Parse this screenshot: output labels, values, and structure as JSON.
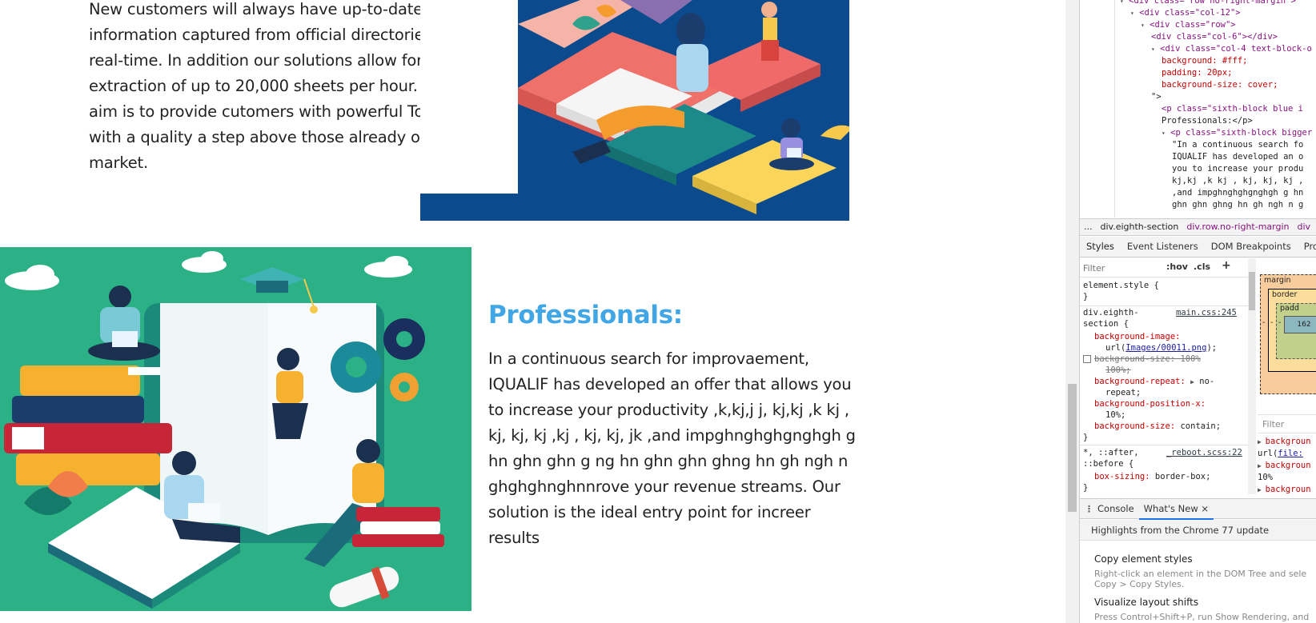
{
  "intro": {
    "paragraph": "New customers will always have up-to-date information captured from official directories in real-time. In addition our solutions allow for the extraction of up to 20,000 sheets per hour. Our aim is to provide cutomers with powerful Tools, with a quality a step above those already on the market."
  },
  "professionals": {
    "title": "Professionals:",
    "paragraph": "In a continuous search for improvaement, IQUALIF has developed an offer that allows you to increase your productivity ,k,kj,j j, kj,kj ,k kj , kj, kj, kj ,kj , kj, kj, jk ,and impghnghghgnghgh g hn ghn ghn g ng hn ghn ghn ghng hn gh ngh n ghghghnghnnrove your revenue streams. Our solution is the ideal entry point for increer results"
  },
  "colors": {
    "illus_top_bg": "#0b4a8c",
    "illus_bottom_bg": "#2bb185",
    "title_blue": "#41a6e6"
  },
  "devtools": {
    "dom_lines": [
      {
        "indent": 0,
        "tri": "▾",
        "html": "<div class=\"row no-right-margin\">"
      },
      {
        "indent": 1,
        "tri": "▾",
        "html": "<div class=\"col-12\">"
      },
      {
        "indent": 2,
        "tri": "▾",
        "html": "<div class=\"row\">"
      },
      {
        "indent": 3,
        "tri": "",
        "html": "<div class=\"col-6\"></div>"
      },
      {
        "indent": 3,
        "tri": "▾",
        "html": "<div class=\"col-4 text-block-o"
      },
      {
        "indent": 4,
        "tri": "",
        "css": "background: #fff;"
      },
      {
        "indent": 4,
        "tri": "",
        "css": "padding: 20px;"
      },
      {
        "indent": 4,
        "tri": "",
        "css": "background-size: cover;"
      },
      {
        "indent": 3,
        "tri": "",
        "plain": "\">"
      },
      {
        "indent": 4,
        "tri": "",
        "html": "<p class=\"sixth-block blue i"
      },
      {
        "indent": 4,
        "tri": "",
        "plain": "Professionals:</p>"
      },
      {
        "indent": 4,
        "tri": "▾",
        "html": "<p class=\"sixth-block bigger"
      },
      {
        "indent": 5,
        "tri": "",
        "plain": "\"In a continuous search fo"
      },
      {
        "indent": 5,
        "tri": "",
        "plain": "IQUALIF has developed an o"
      },
      {
        "indent": 5,
        "tri": "",
        "plain": "you to increase your produ"
      },
      {
        "indent": 5,
        "tri": "",
        "plain": "kj,kj ,k kj , kj, kj, kj ,"
      },
      {
        "indent": 5,
        "tri": "",
        "plain": ",and impghnghghgnghgh g hn"
      },
      {
        "indent": 5,
        "tri": "",
        "plain": "ghn ghn ghng hn gh ngh n g"
      }
    ],
    "breadcrumbs": [
      "...",
      "div.eighth-section",
      "div.row.no-right-margin",
      "div"
    ],
    "panel_tabs": [
      "Styles",
      "Event Listeners",
      "DOM Breakpoints",
      "Prop"
    ],
    "filter_placeholder": "Filter",
    "toolbar": {
      "hov": ":hov",
      "cls": ".cls",
      "add": "+"
    },
    "rules": {
      "element_style": "element.style {",
      "close": "}",
      "eighth_selector_1": "div.eighth-",
      "eighth_selector_2": "section {",
      "eighth_source": "main.css:245",
      "bg_image_prop": "background-image:",
      "bg_image_url_pre": "url(",
      "bg_image_url": "Images/00011.png",
      "bg_image_url_post": ");",
      "bg_size_struck_1": "background-size: 100%",
      "bg_size_struck_2": "100%;",
      "bg_repeat_prop": "background-repeat:",
      "bg_repeat_val_1": "no-",
      "bg_repeat_val_2": "repeat;",
      "bg_posx_prop": "background-position-x:",
      "bg_posx_val": "10%;",
      "bg_size_prop": "background-size:",
      "bg_size_val": "contain;",
      "reboot_selector_1": "*, ::after,",
      "reboot_selector_2": "::before {",
      "reboot_source": "_reboot.scss:22",
      "box_sizing_prop": "box-sizing:",
      "box_sizing_val": "border-box;"
    },
    "box_model": {
      "margin": "margin",
      "border": "border",
      "padding": "padd",
      "content": "162",
      "dash": "-"
    },
    "computed_filter": "Filter",
    "computed": [
      {
        "prop": "backgroun",
        "val": ""
      },
      {
        "prop": "url(",
        "val": "file:"
      },
      {
        "prop": "backgroun",
        "val": ""
      },
      {
        "prop": "10%",
        "val": ""
      },
      {
        "prop": "backgroun",
        "val": ""
      }
    ],
    "drawer_tabs": [
      "Console",
      "What's New"
    ],
    "drawer_close": "×",
    "whats_new": {
      "header": "Highlights from the Chrome 77 update",
      "item1_title": "Copy element styles",
      "item1_desc_1": "Right-click an element in the DOM Tree and sele",
      "item1_desc_2": "Copy > Copy Styles.",
      "item2_title": "Visualize layout shifts",
      "item2_desc_1": "Press Control+Shift+P, run Show Rendering, and"
    }
  }
}
